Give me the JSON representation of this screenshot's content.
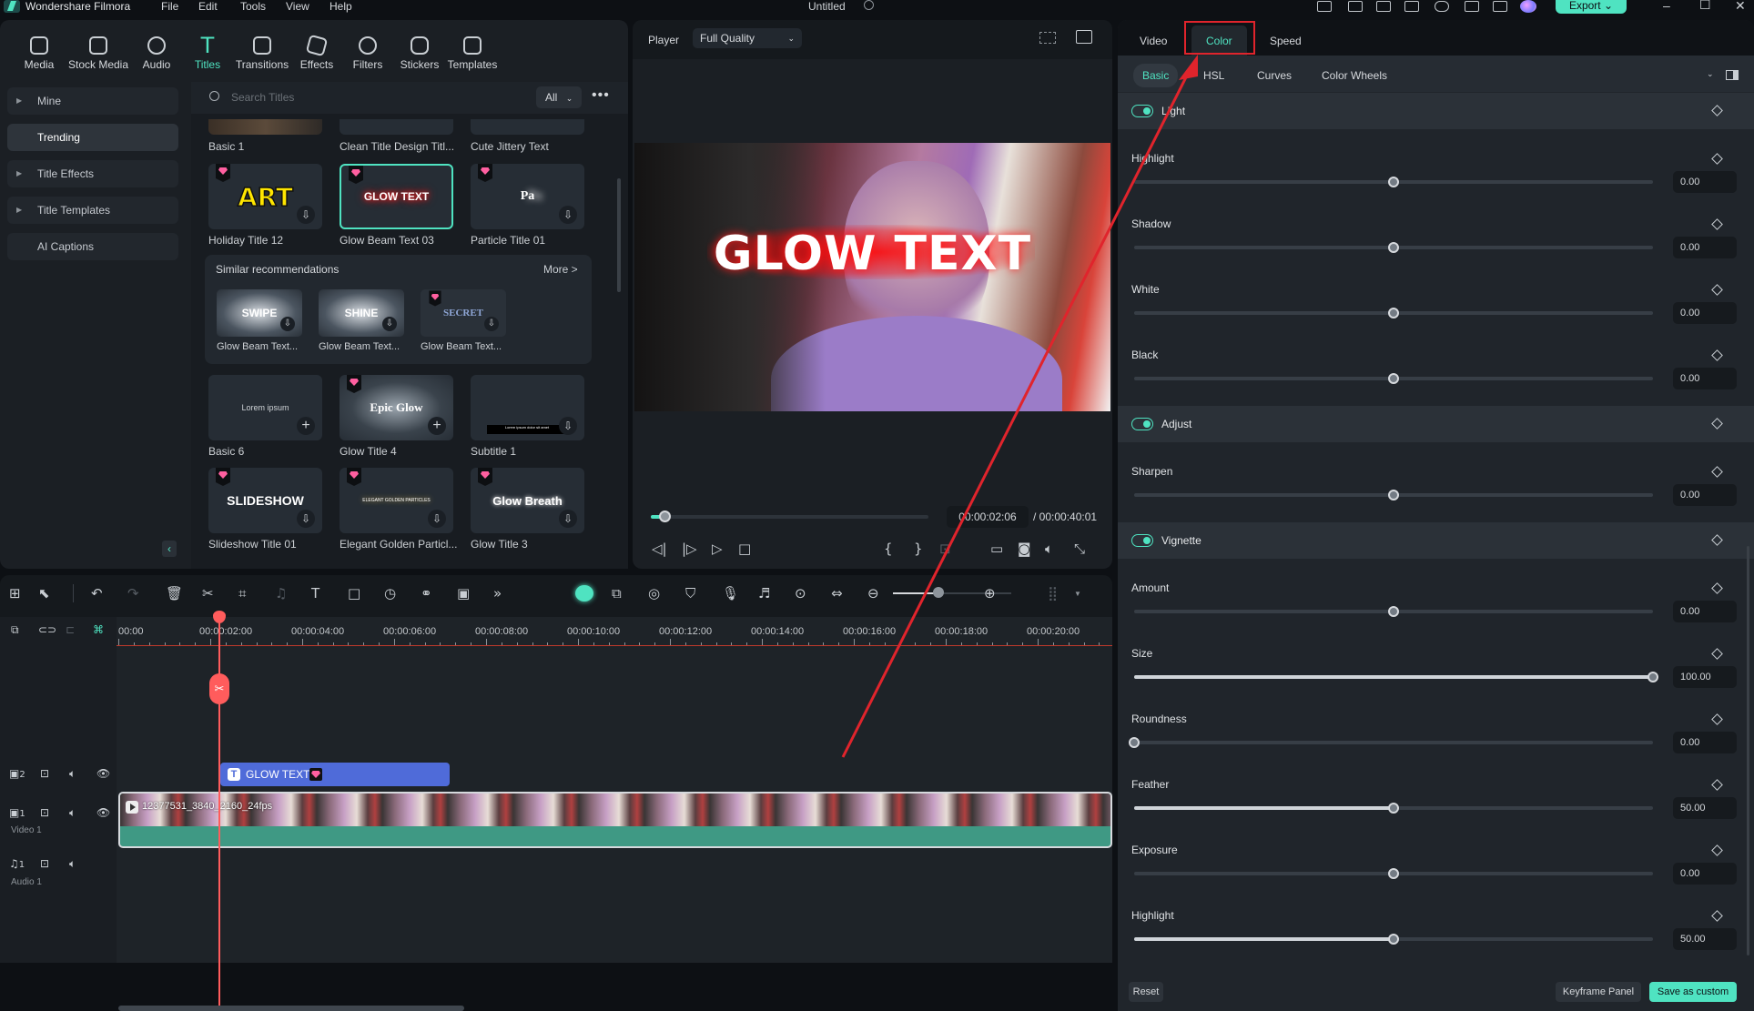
{
  "app": {
    "name": "Wondershare Filmora",
    "menu": [
      "File",
      "Edit",
      "Tools",
      "View",
      "Help"
    ],
    "document_title": "Untitled",
    "export_label": "Export",
    "window_controls": [
      "minimize",
      "maximize",
      "close"
    ]
  },
  "toolbar": {
    "tools": [
      {
        "label": "Media",
        "icon": "media-icon"
      },
      {
        "label": "Stock Media",
        "icon": "stock-media-icon"
      },
      {
        "label": "Audio",
        "icon": "audio-icon"
      },
      {
        "label": "Titles",
        "icon": "titles-icon",
        "active": true
      },
      {
        "label": "Transitions",
        "icon": "transitions-icon"
      },
      {
        "label": "Effects",
        "icon": "effects-icon"
      },
      {
        "label": "Filters",
        "icon": "filters-icon"
      },
      {
        "label": "Stickers",
        "icon": "stickers-icon"
      },
      {
        "label": "Templates",
        "icon": "templates-icon"
      }
    ]
  },
  "sidebar": {
    "items": [
      {
        "label": "Mine",
        "expandable": true
      },
      {
        "label": "Trending",
        "active": true
      },
      {
        "label": "Title Effects",
        "expandable": true
      },
      {
        "label": "Title Templates",
        "expandable": true
      },
      {
        "label": "AI Captions"
      }
    ]
  },
  "titles": {
    "search_placeholder": "Search Titles",
    "filter_value": "All",
    "top_row": [
      "Basic 1",
      "Clean Title Design Titl...",
      "Cute Jittery Text"
    ],
    "row2": [
      {
        "label": "Holiday Title 12",
        "preview": "ART",
        "premium": true
      },
      {
        "label": "Glow Beam Text 03",
        "preview": "GLOW TEXT",
        "premium": true,
        "selected": true
      },
      {
        "label": "Particle Title 01",
        "preview": "Pa",
        "premium": true
      }
    ],
    "recommendations": {
      "title": "Similar recommendations",
      "more": "More >",
      "items": [
        {
          "label": "Glow Beam Text...",
          "preview": "SWIPE"
        },
        {
          "label": "Glow Beam Text...",
          "preview": "SHINE"
        },
        {
          "label": "Glow Beam Text...",
          "preview": "SECRET"
        }
      ]
    },
    "row3": [
      {
        "label": "Basic 6",
        "preview": "Lorem ipsum",
        "premium": false,
        "action": "add"
      },
      {
        "label": "Glow Title 4",
        "preview": "Epic Glow",
        "premium": true,
        "action": "add"
      },
      {
        "label": "Subtitle 1",
        "preview": "Lorem ipsum dolor sit amet",
        "premium": false,
        "action": "download"
      }
    ],
    "row4": [
      {
        "label": "Slideshow Title 01",
        "preview": "SLIDESHOW",
        "premium": true
      },
      {
        "label": "Elegant Golden Particl...",
        "preview": "ELEGANT GOLDEN PARTICLES",
        "premium": true
      },
      {
        "label": "Glow Title 3",
        "preview": "Glow Breath",
        "premium": true
      }
    ]
  },
  "player": {
    "label": "Player",
    "quality": "Full Quality",
    "overlay_text": "GLOW TEXT",
    "current_time": "00:00:02:06",
    "total_time": "/ 00:00:40:01",
    "progress_fraction": 0.05
  },
  "properties": {
    "tabs": [
      "Video",
      "Color",
      "Speed"
    ],
    "active_tab": "Color",
    "subtabs": [
      "Basic",
      "HSL",
      "Curves",
      "Color Wheels"
    ],
    "active_subtab": "Basic",
    "sections": [
      {
        "title": "Light",
        "enabled": true,
        "params": [
          {
            "label": "Highlight",
            "value": "0.00",
            "fraction": 0.5
          },
          {
            "label": "Shadow",
            "value": "0.00",
            "fraction": 0.5
          },
          {
            "label": "White",
            "value": "0.00",
            "fraction": 0.5
          },
          {
            "label": "Black",
            "value": "0.00",
            "fraction": 0.5
          }
        ]
      },
      {
        "title": "Adjust",
        "enabled": true,
        "params": [
          {
            "label": "Sharpen",
            "value": "0.00",
            "fraction": 0.5
          }
        ]
      },
      {
        "title": "Vignette",
        "enabled": true,
        "params": [
          {
            "label": "Amount",
            "value": "0.00",
            "fraction": 0.5
          },
          {
            "label": "Size",
            "value": "100.00",
            "fraction": 1.0,
            "filled": true
          },
          {
            "label": "Roundness",
            "value": "0.00",
            "fraction": 0.0
          },
          {
            "label": "Feather",
            "value": "50.00",
            "fraction": 0.5,
            "filled": true
          },
          {
            "label": "Exposure",
            "value": "0.00",
            "fraction": 0.5
          },
          {
            "label": "Highlight",
            "value": "50.00",
            "fraction": 0.5,
            "filled": true
          }
        ]
      }
    ],
    "reset_label": "Reset",
    "keyframe_label": "Keyframe Panel",
    "save_label": "Save as custom"
  },
  "timeline": {
    "ruler": [
      "00:00",
      "00:00:02:00",
      "00:00:04:00",
      "00:00:06:00",
      "00:00:08:00",
      "00:00:10:00",
      "00:00:12:00",
      "00:00:14:00",
      "00:00:16:00",
      "00:00:18:00",
      "00:00:20:00"
    ],
    "tracks": [
      {
        "id": "2",
        "name": ""
      },
      {
        "id": "1",
        "name": "Video 1"
      },
      {
        "id": "1",
        "name": "Audio 1",
        "type": "audio"
      }
    ],
    "title_clip": "GLOW TEXT",
    "video_clip": "12377531_3840_2160_24fps",
    "zoom_fraction": 0.55
  },
  "colors": {
    "accent": "#4fe3c1",
    "annotation_red": "#e0242c",
    "title_clip": "#4f6bd9",
    "video_clip": "#3f9984",
    "playhead": "#ff5c5c"
  }
}
